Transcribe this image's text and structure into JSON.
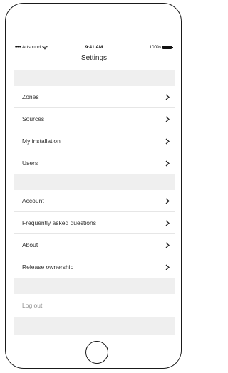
{
  "status_bar": {
    "signal": "•••••",
    "carrier": "Artsound",
    "time": "9:41 AM",
    "battery": "100%"
  },
  "header": {
    "title": "Settings"
  },
  "group1": {
    "items": [
      {
        "label": "Zones"
      },
      {
        "label": "Sources"
      },
      {
        "label": "My installation"
      },
      {
        "label": "Users"
      }
    ]
  },
  "group2": {
    "items": [
      {
        "label": "Account"
      },
      {
        "label": "Frequently asked questions"
      },
      {
        "label": "About"
      },
      {
        "label": "Release ownership"
      }
    ]
  },
  "logout": {
    "label": "Log out"
  },
  "icons": {
    "chevron": "chevron-right-icon",
    "wifi": "wifi-icon",
    "battery": "battery-icon"
  }
}
